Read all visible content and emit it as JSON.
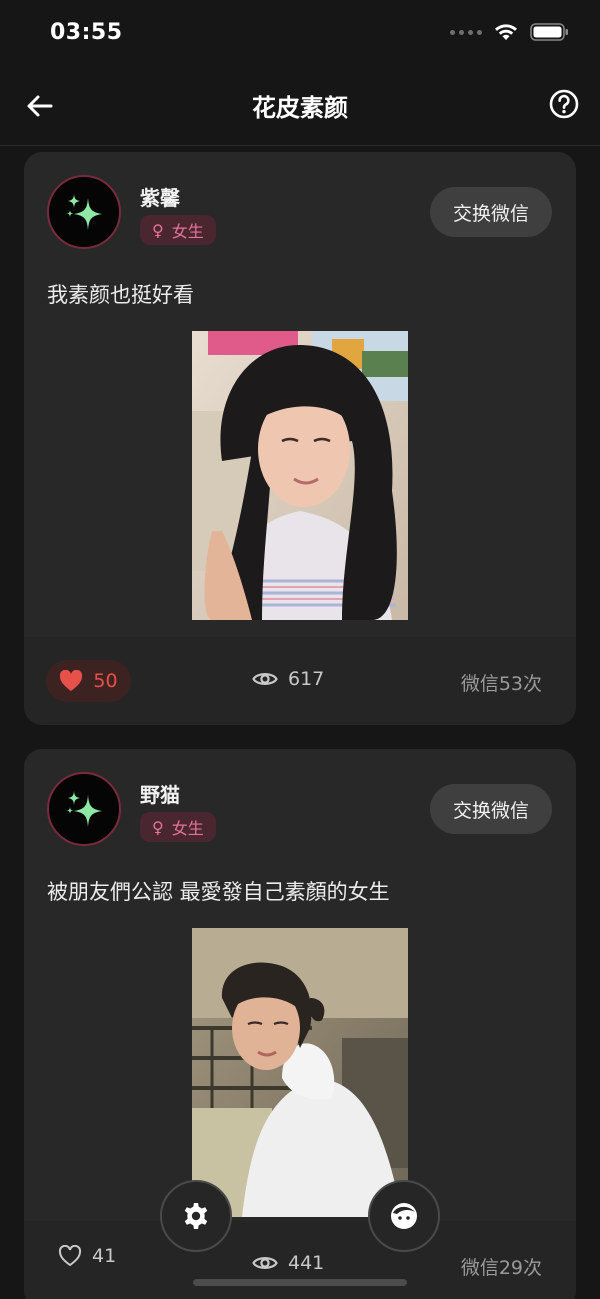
{
  "status_bar": {
    "time": "03:55"
  },
  "nav": {
    "title": "花皮素颜"
  },
  "posts": [
    {
      "username": "紫馨",
      "gender_symbol": "♀",
      "gender_label": "女生",
      "action_label": "交换微信",
      "text": "我素颜也挺好看",
      "likes": "50",
      "liked": true,
      "views": "617",
      "wechat_count": "微信53次"
    },
    {
      "username": "野猫",
      "gender_symbol": "♀",
      "gender_label": "女生",
      "action_label": "交换微信",
      "text": "被朋友們公認 最愛發自己素顏的女生",
      "likes": "41",
      "liked": false,
      "views": "441",
      "wechat_count": "微信29次"
    }
  ],
  "colors": {
    "background": "#161616",
    "card": "#282828",
    "accent_like": "#e8504a",
    "gender_tag_text": "#e6739a",
    "sparkle": "#8ee8a4"
  },
  "icons": [
    "back-arrow-icon",
    "help-icon",
    "sparkle-icon",
    "heart-icon",
    "eye-icon",
    "gear-icon",
    "face-icon",
    "wifi-icon",
    "battery-icon"
  ]
}
